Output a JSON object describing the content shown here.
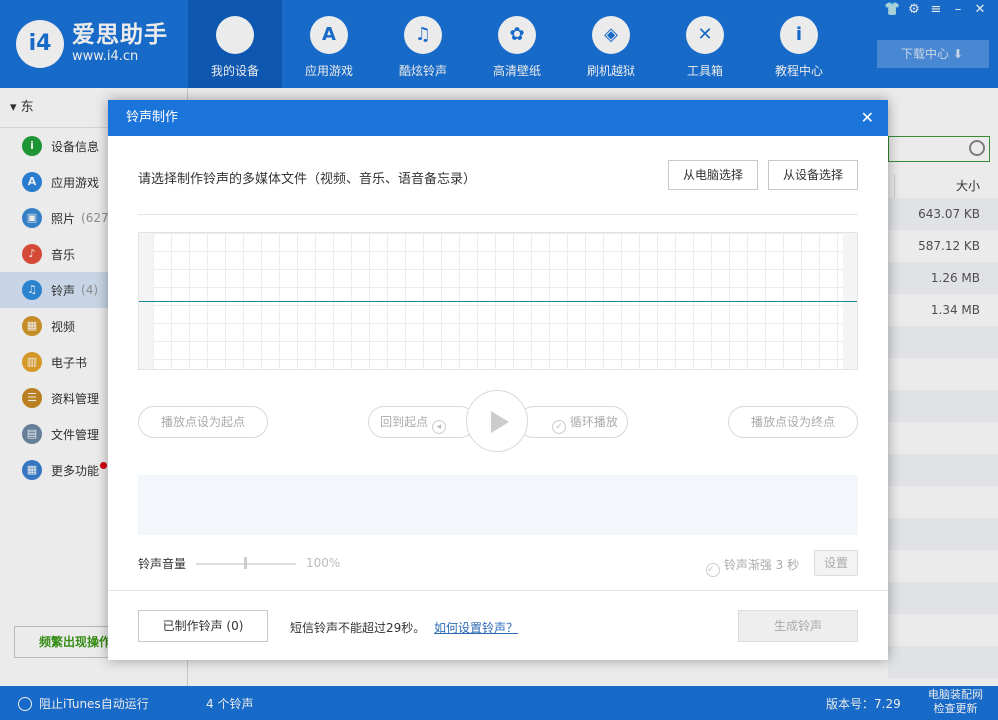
{
  "app": {
    "brand_name": "爱思助手",
    "brand_url": "www.i4.cn",
    "logo_text": "i4"
  },
  "nav": [
    {
      "label": "我的设备",
      "icon": "apple-icon",
      "glyph": "",
      "active": true
    },
    {
      "label": "应用游戏",
      "icon": "app-store-icon",
      "glyph": "A"
    },
    {
      "label": "酷炫铃声",
      "icon": "bell-icon",
      "glyph": "♫"
    },
    {
      "label": "高清壁纸",
      "icon": "flower-icon",
      "glyph": "✿"
    },
    {
      "label": "刷机越狱",
      "icon": "box-icon",
      "glyph": "◈"
    },
    {
      "label": "工具箱",
      "icon": "tools-icon",
      "glyph": "✕"
    },
    {
      "label": "教程中心",
      "icon": "info-icon",
      "glyph": "i"
    }
  ],
  "window": {
    "download_center": "下载中心"
  },
  "sidebar": {
    "device_name": "东",
    "items": [
      {
        "label": "设备信息",
        "count": "",
        "icon": "info-icon",
        "color": "#22a33a",
        "glyph": "i"
      },
      {
        "label": "应用游戏",
        "count": "",
        "icon": "app-store-icon",
        "color": "#2d88e3",
        "glyph": "A"
      },
      {
        "label": "照片",
        "count": "(627",
        "icon": "photo-icon",
        "color": "#3b8bd6",
        "glyph": "▣"
      },
      {
        "label": "音乐",
        "count": "",
        "icon": "music-icon",
        "color": "#e8503c",
        "glyph": "♪"
      },
      {
        "label": "铃声",
        "count": "(4)",
        "icon": "bell-icon",
        "color": "#2f8fe0",
        "glyph": "♫",
        "active": true
      },
      {
        "label": "视频",
        "count": "",
        "icon": "video-icon",
        "color": "#d59a2a",
        "glyph": "▦"
      },
      {
        "label": "电子书",
        "count": "",
        "icon": "book-icon",
        "color": "#e8a52a",
        "glyph": "▥"
      },
      {
        "label": "资料管理",
        "count": "",
        "icon": "contacts-icon",
        "color": "#c98a24",
        "glyph": "☰"
      },
      {
        "label": "文件管理",
        "count": "",
        "icon": "file-icon",
        "color": "#6f8aa8",
        "glyph": "▤"
      },
      {
        "label": "更多功能",
        "count": "",
        "icon": "grid-icon",
        "color": "#3b7fd0",
        "glyph": "▦",
        "badge": true
      }
    ],
    "bottom_button": "频繁出现操作"
  },
  "list": {
    "size_header": "大小",
    "sizes": [
      "643.07 KB",
      "587.12 KB",
      "1.26 MB",
      "1.34 MB"
    ]
  },
  "statusbar": {
    "itunes_label": "阻止iTunes自动运行",
    "count_label": "4 个铃声",
    "version_label": "版本号：7.29",
    "watermark_line1": "电脑装配网",
    "watermark_line2": "检查更新"
  },
  "modal": {
    "title": "铃声制作",
    "prompt": "请选择制作铃声的多媒体文件（视频、音乐、语音备忘录）",
    "from_pc": "从电脑选择",
    "from_device": "从设备选择",
    "set_start": "播放点设为起点",
    "back_to_start": "回到起点",
    "loop_play": "循环播放",
    "set_end": "播放点设为终点",
    "volume_label": "铃声音量",
    "volume_value": "100%",
    "fade_label": "铃声渐强 3 秒",
    "settings": "设置",
    "made_ringtones": "已制作铃声 (0)",
    "sms_note": "短信铃声不能超过29秒。",
    "how_to_link": "如何设置铃声？",
    "generate": "生成铃声"
  }
}
